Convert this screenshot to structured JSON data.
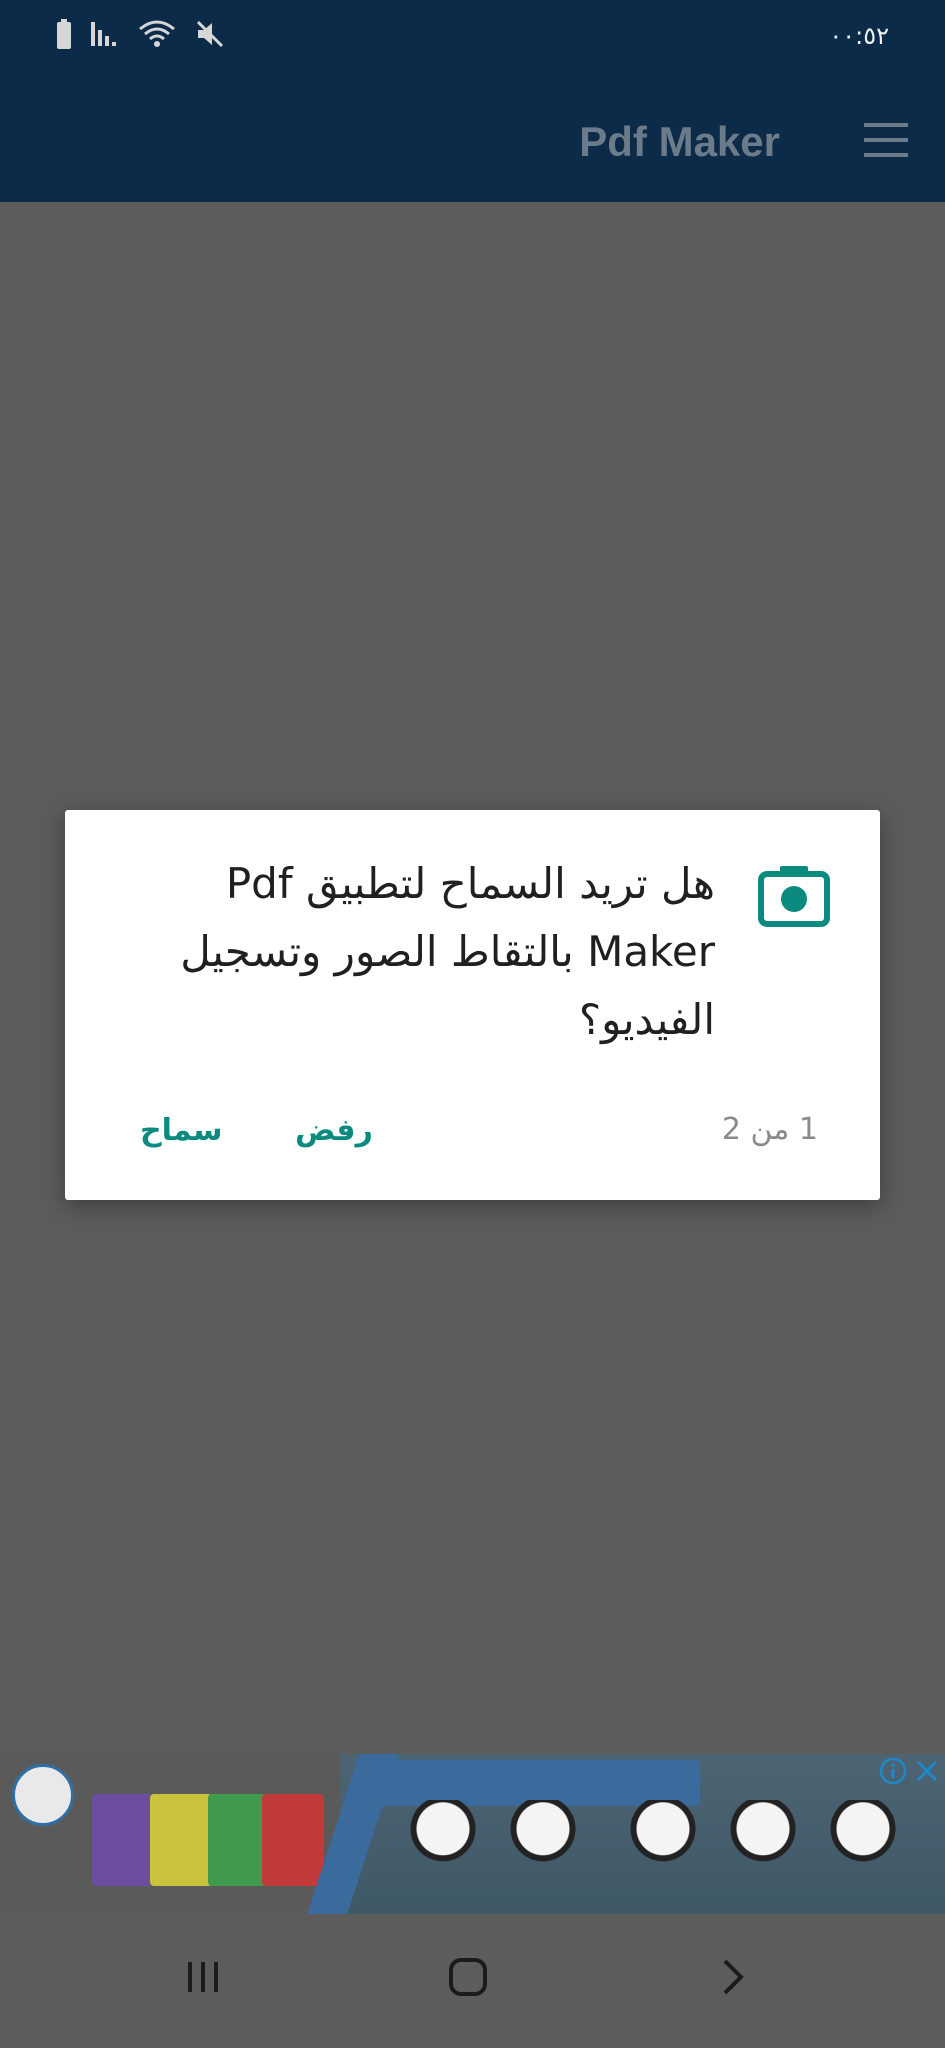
{
  "status_bar": {
    "time": "٠٠:٥٢",
    "icons": [
      "battery-icon",
      "signal-icon",
      "wifi-icon",
      "mute-icon"
    ]
  },
  "app_bar": {
    "title": "Pdf Maker",
    "menu_icon": "menu-icon"
  },
  "dialog": {
    "icon": "camera-icon",
    "message": "هل تريد السماح لتطبيق Pdf Maker بالتقاط الصور وتسجيل الفيديو؟",
    "counter": "1 من 2",
    "deny_label": "رفض",
    "allow_label": "سماح",
    "accent_color": "#0b8a80"
  },
  "ad_banner": {
    "info_icon": "info-icon",
    "close_icon": "close-icon"
  },
  "nav_bar": {
    "buttons": [
      "recent-apps-icon",
      "home-icon",
      "back-icon"
    ]
  },
  "colors": {
    "app_bar": "#0c2b49",
    "scrim": "#5c5c5c",
    "dialog_bg": "#ffffff"
  }
}
